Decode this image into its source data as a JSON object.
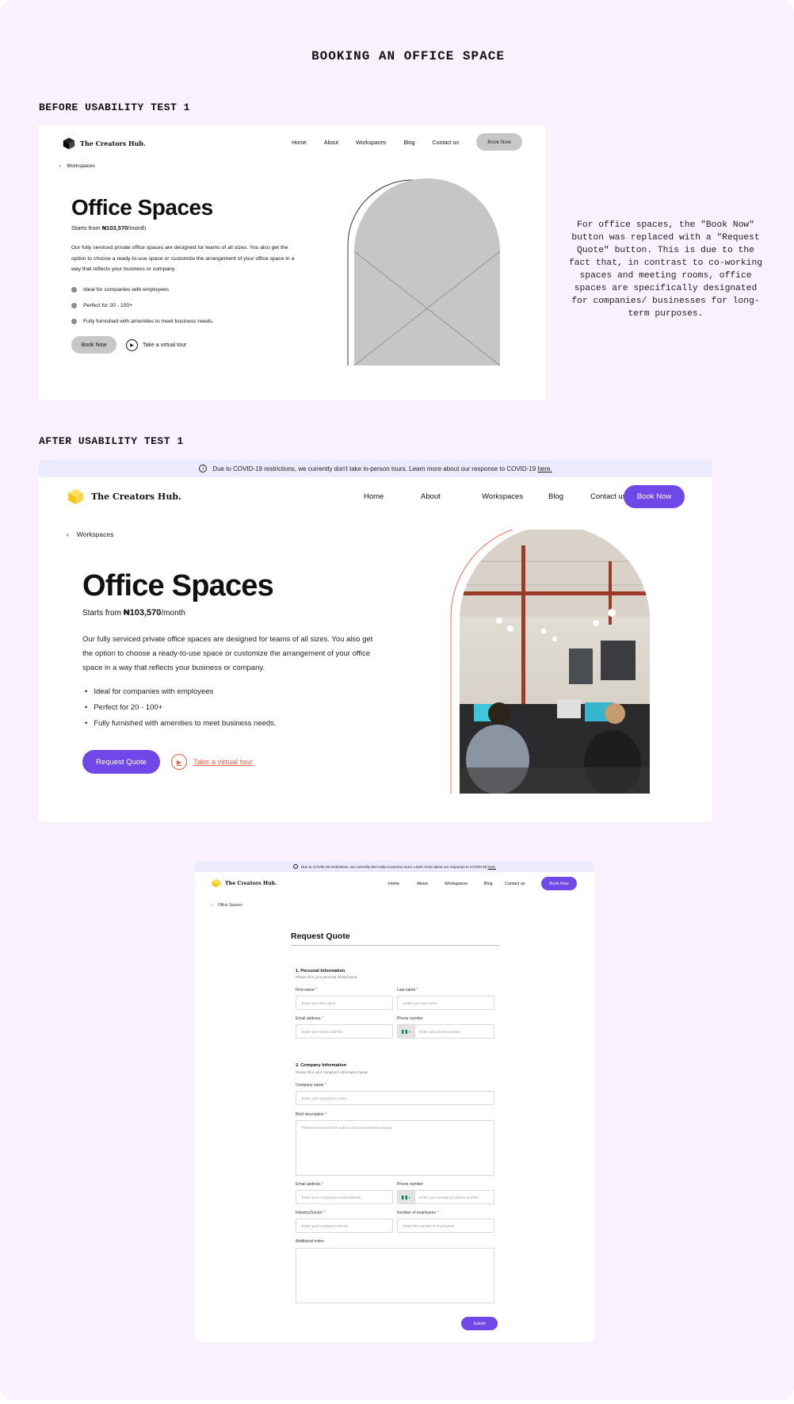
{
  "page": {
    "title": "BOOKING AN OFFICE SPACE",
    "before_label": "BEFORE USABILITY TEST 1",
    "after_label": "AFTER USABILITY TEST 1",
    "note": "For office spaces, the \"Book Now\" button was replaced with a \"Request Quote\" button. This is due to the fact that, in contrast to co-working spaces and meeting rooms, office spaces are specifically designated for companies/ businesses for long-term purposes."
  },
  "before": {
    "logo": "The Creators Hub.",
    "nav": [
      "Home",
      "About",
      "Workspaces",
      "Blog",
      "Contact us"
    ],
    "book_now": "Book Now",
    "breadcrumb": "Workspaces",
    "heading": "Office Spaces",
    "price_prefix": "Starts from ",
    "price": "₦103,570",
    "price_suffix": "/month",
    "description": "Our fully serviced private office spaces are designed for teams of all sizes. You also get the option to choose a ready-to-use space or customize the arrangement of your office space in a way that reflects your business or company.",
    "features": [
      "Ideal for companies with employees",
      "Perfect for 20 - 100+",
      "Fully furnished with amenities to meet business needs."
    ],
    "cta_primary": "Book Now",
    "cta_secondary": "Take a virtual tour"
  },
  "after": {
    "banner_text": "Due to COVID-19 restrictions, we currently don't take in-person tours. Learn more about our response to COVID-19 ",
    "banner_link": "here.",
    "logo": "The Creators Hub.",
    "nav": [
      "Home",
      "About",
      "Workspaces",
      "Blog",
      "Contact us"
    ],
    "book_now": "Book Now",
    "breadcrumb": "Workspaces",
    "heading": "Office Spaces",
    "price_prefix": "Starts from ",
    "price": "₦103,570",
    "price_suffix": "/month",
    "description": "Our fully serviced private office spaces are designed for teams of all sizes. You also get the option to choose a ready-to-use space or customize the arrangement of your office space in a way that reflects your business or company.",
    "features": [
      "Ideal for companies with employees",
      "Perfect for 20 - 100+",
      "Fully furnished with amenities to meet business needs."
    ],
    "cta_primary": "Request Quote",
    "cta_secondary": "Take a virtual tour"
  },
  "form_page": {
    "banner_text": "Due to COVID-19 restrictions, we currently don't take in-person tours. Learn more about our response to COVID-19 ",
    "banner_link": "here.",
    "logo": "The Creators Hub.",
    "nav": [
      "Home",
      "About",
      "Workspaces",
      "Blog",
      "Contact us"
    ],
    "book_now": "Book Now",
    "breadcrumb": "Office Spaces",
    "title": "Request Quote",
    "section1_title": "1. Personal Information",
    "section1_sub": "Please fill in your personal details below",
    "first_name_label": "First name",
    "first_name_placeholder": "Enter your first name",
    "last_name_label": "Last name",
    "last_name_placeholder": "Enter your last name",
    "email_label": "Email address",
    "email_placeholder": "Enter your email address",
    "phone_label": "Phone number",
    "phone_placeholder": "Enter your phone number",
    "section2_title": "2. Company Information",
    "section2_sub": "Please fill in your company's information below",
    "company_name_label": "Company name",
    "company_name_placeholder": "Enter your company's name",
    "brief_label": "Brief description",
    "brief_placeholder": "Please summarize the nature of your business/company",
    "company_email_label": "Email address",
    "company_email_placeholder": "Enter your company's email address",
    "company_phone_label": "Phone number",
    "company_phone_placeholder": "Enter your company's phone number",
    "industry_label": "Industry/Sector",
    "industry_placeholder": "Enter your company's sector",
    "employees_label": "Number of employees",
    "employees_placeholder": "Enter the number of employees",
    "notes_label": "Additional notes",
    "submit": "Submit",
    "required_mark": "*"
  },
  "colors": {
    "accent": "#7048e8",
    "link": "#f25c3c",
    "banner": "#ecebfd",
    "canvas": "#f9f1fe"
  }
}
